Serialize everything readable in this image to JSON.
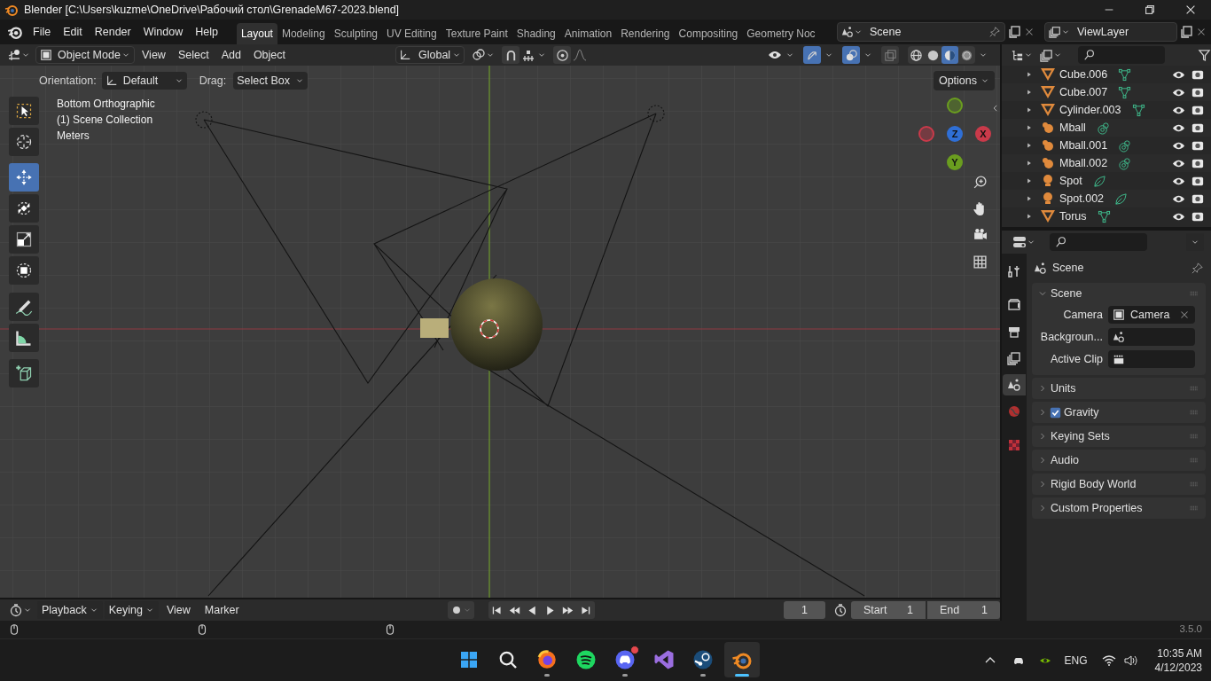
{
  "window": {
    "title": "Blender [C:\\Users\\kuzme\\OneDrive\\Рабочий стол\\GrenadeM67-2023.blend]"
  },
  "menu": [
    "File",
    "Edit",
    "Render",
    "Window",
    "Help"
  ],
  "workspaces": [
    {
      "label": "Layout",
      "selected": true
    },
    {
      "label": "Modeling",
      "selected": false
    },
    {
      "label": "Sculpting",
      "selected": false
    },
    {
      "label": "UV Editing",
      "selected": false
    },
    {
      "label": "Texture Paint",
      "selected": false
    },
    {
      "label": "Shading",
      "selected": false
    },
    {
      "label": "Animation",
      "selected": false
    },
    {
      "label": "Rendering",
      "selected": false
    },
    {
      "label": "Compositing",
      "selected": false
    },
    {
      "label": "Geometry Noc",
      "selected": false
    }
  ],
  "scene_field": {
    "value": "Scene"
  },
  "view_layer_field": {
    "value": "ViewLayer"
  },
  "viewport_header": {
    "mode": "Object Mode",
    "menus": [
      "View",
      "Select",
      "Add",
      "Object"
    ],
    "orientation": "Global",
    "toggles": [
      {
        "kind": "snap",
        "on": false
      },
      {
        "kind": "proportional",
        "on": false
      },
      {
        "kind": "gizmo",
        "on": true
      },
      {
        "kind": "overlay",
        "on": true
      },
      {
        "kind": "xray",
        "on": false
      }
    ],
    "shading": [
      {
        "kind": "wireframe",
        "selected": false
      },
      {
        "kind": "solid",
        "selected": false
      },
      {
        "kind": "material",
        "selected": true
      },
      {
        "kind": "rendered",
        "selected": false
      }
    ]
  },
  "tool_settings": {
    "orientation_label": "Orientation:",
    "orientation": "Default",
    "drag_label": "Drag:",
    "drag": "Select Box",
    "options": "Options"
  },
  "viewport_info": [
    "Bottom Orthographic",
    "(1) Scene Collection",
    "Meters"
  ],
  "toolbar": [
    {
      "kind": "select",
      "selected": false
    },
    {
      "kind": "cursor",
      "selected": false
    },
    {
      "kind": "move",
      "selected": true
    },
    {
      "kind": "rotate",
      "selected": false
    },
    {
      "kind": "scale",
      "selected": false
    },
    {
      "kind": "transform",
      "selected": false
    },
    {
      "kind": "annotate",
      "selected": false
    },
    {
      "kind": "measure",
      "selected": false
    },
    {
      "kind": "add-cube",
      "selected": false
    }
  ],
  "gizmo": [
    {
      "label": "Z",
      "color": "#2f6fd6"
    },
    {
      "label": "X",
      "color": "#c93a4a"
    },
    {
      "label": "Y",
      "color": "#6a9d1f"
    }
  ],
  "outliner": [
    {
      "name": "Cube.006",
      "kind": "mesh",
      "visible": true,
      "renderable": true
    },
    {
      "name": "Cube.007",
      "kind": "mesh",
      "visible": true,
      "renderable": true
    },
    {
      "name": "Cylinder.003",
      "kind": "mesh",
      "visible": true,
      "renderable": true
    },
    {
      "name": "Mball",
      "kind": "metaball",
      "visible": true,
      "renderable": true
    },
    {
      "name": "Mball.001",
      "kind": "metaball",
      "visible": true,
      "renderable": true
    },
    {
      "name": "Mball.002",
      "kind": "metaball",
      "visible": true,
      "renderable": true
    },
    {
      "name": "Spot",
      "kind": "light",
      "visible": true,
      "renderable": true
    },
    {
      "name": "Spot.002",
      "kind": "light",
      "visible": true,
      "renderable": true
    },
    {
      "name": "Torus",
      "kind": "mesh",
      "visible": true,
      "renderable": true
    }
  ],
  "properties": {
    "tabs": [
      {
        "kind": "tool",
        "selected": false
      },
      {
        "kind": "render",
        "selected": false
      },
      {
        "kind": "output",
        "selected": false
      },
      {
        "kind": "view-layer",
        "selected": false
      },
      {
        "kind": "scene",
        "selected": true
      },
      {
        "kind": "world",
        "selected": false
      },
      {
        "kind": "texture",
        "selected": false
      }
    ],
    "context": "Scene",
    "panels": [
      {
        "label": "Scene",
        "expanded": true,
        "fields": [
          {
            "label": "Camera",
            "kind": "camera",
            "value": "Camera"
          },
          {
            "label": "Backgroun...",
            "kind": "scene"
          },
          {
            "label": "Active Clip",
            "kind": "clip"
          }
        ]
      },
      {
        "label": "Units",
        "expanded": false
      },
      {
        "label": "Gravity",
        "expanded": false,
        "checked": true
      },
      {
        "label": "Keying Sets",
        "expanded": false
      },
      {
        "label": "Audio",
        "expanded": false
      },
      {
        "label": "Rigid Body World",
        "expanded": false
      },
      {
        "label": "Custom Properties",
        "expanded": false
      }
    ]
  },
  "timeline": {
    "menus": [
      "Playback",
      "Keying"
    ],
    "plain_menus": [
      "View",
      "Marker"
    ],
    "current_frame": "1",
    "start_label": "Start",
    "start": "1",
    "end_label": "End",
    "end": "1"
  },
  "status_bar": {
    "version": "3.5.0"
  },
  "taskbar": {
    "apps": [
      {
        "kind": "start",
        "selected": false,
        "running": false,
        "notification": false
      },
      {
        "kind": "search",
        "selected": false,
        "running": false,
        "notification": false
      },
      {
        "kind": "firefox",
        "selected": false,
        "running": true,
        "notification": false
      },
      {
        "kind": "spotify",
        "selected": false,
        "running": false,
        "notification": false
      },
      {
        "kind": "discord",
        "selected": false,
        "running": true,
        "notification": true
      },
      {
        "kind": "visual-studio",
        "selected": false,
        "running": false,
        "notification": false
      },
      {
        "kind": "steam",
        "selected": false,
        "running": true,
        "notification": false
      },
      {
        "kind": "blender",
        "selected": true,
        "running": true,
        "notification": false
      }
    ],
    "language": "ENG",
    "time": "10:35 AM",
    "date": "4/12/2023"
  }
}
